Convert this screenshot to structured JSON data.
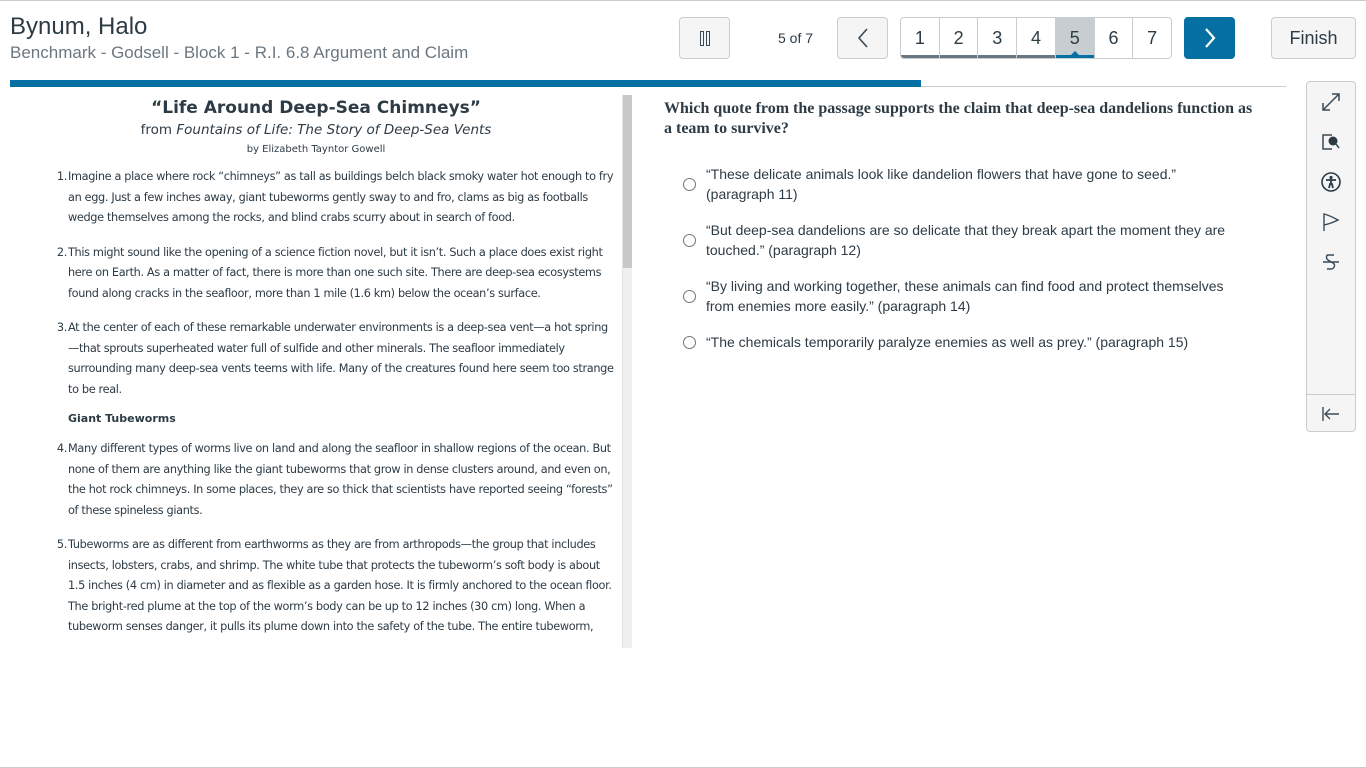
{
  "header": {
    "student_name": "Bynum, Halo",
    "quiz_title": "Benchmark - Godsell - Block 1 - R.I. 6.8 Argument and Claim"
  },
  "nav": {
    "pause_icon": "pause-icon",
    "counter": "5 of 7",
    "prev_icon": "chevron-left-icon",
    "next_icon": "chevron-right-icon",
    "pages": [
      {
        "label": "1",
        "state": "visited"
      },
      {
        "label": "2",
        "state": "visited"
      },
      {
        "label": "3",
        "state": "visited"
      },
      {
        "label": "4",
        "state": "visited"
      },
      {
        "label": "5",
        "state": "current"
      },
      {
        "label": "6",
        "state": "unvisited"
      },
      {
        "label": "7",
        "state": "unvisited"
      }
    ],
    "finish_label": "Finish"
  },
  "progress": {
    "current": 5,
    "total": 7,
    "color": "#0770a3"
  },
  "passage": {
    "title": "“Life Around Deep-Sea Chimneys”",
    "source_prefix": "from ",
    "source_work": "Fountains of Life: The Story of Deep-Sea Vents",
    "author": "by Elizabeth Tayntor Gowell",
    "paragraphs": [
      {
        "num": "1.",
        "text": "Imagine a place where rock “chimneys” as tall as buildings belch black smoky water hot enough to fry an egg. Just a few inches away, giant tubeworms gently sway to and fro, clams as big as footballs wedge themselves among the rocks, and blind crabs scurry about in search of food."
      },
      {
        "num": "2.",
        "text": "This might sound like the opening of a science fiction novel, but it isn’t. Such a place does exist right here on Earth. As a matter of fact, there is more than one such site. There are deep-sea ecosystems found along cracks in the seafloor, more than 1 mile (1.6 km) below the ocean’s surface."
      },
      {
        "num": "3.",
        "text": "At the center of each of these remarkable underwater environments is a deep-sea vent—a hot spring—that sprouts superheated water full of sulfide and other minerals. The seafloor immediately surrounding many deep-sea vents teems with life. Many of the creatures found here seem too strange to be real."
      },
      {
        "num": "4.",
        "text": "Many different types of worms live on land and along the seafloor in shallow regions of the ocean. But none of them are anything like the giant tubeworms that grow in dense clusters around, and even on, the hot rock chimneys. In some places, they are so thick that scientists have reported seeing “forests” of these spineless giants."
      },
      {
        "num": "5.",
        "text": "Tubeworms are as different from earthworms as they are from arthropods—the group that includes insects, lobsters, crabs, and shrimp. The white tube that protects the tubeworm’s soft body is about 1.5 inches (4 cm) in diameter and as flexible as a garden hose. It is firmly anchored to the ocean floor. The bright-red plume at the top of the worm’s body can be up to 12 inches (30 cm) long. When a tubeworm senses danger, it pulls its plume down into the safety of the tube. The entire tubeworm,"
      }
    ],
    "section_heading": "Giant Tubeworms"
  },
  "question": {
    "prompt": "Which quote from the passage supports the claim that deep-sea dandelions function as a team to survive?",
    "answers": [
      "“These delicate animals look like dandelion flowers that have gone to seed.” (paragraph 11)",
      "“But deep-sea dandelions are so delicate that they break apart the moment they are touched.” (paragraph 12)",
      "“By living and working together, these animals can find food and protect themselves from enemies more easily.” (paragraph 14)",
      "“The chemicals temporarily paralyze enemies as well as prey.” (paragraph 15)"
    ]
  },
  "tools": [
    {
      "name": "expand-icon"
    },
    {
      "name": "magnifier-icon"
    },
    {
      "name": "accessibility-icon"
    },
    {
      "name": "flag-icon"
    },
    {
      "name": "strikethrough-icon"
    },
    {
      "name": "collapse-panel-icon"
    }
  ]
}
